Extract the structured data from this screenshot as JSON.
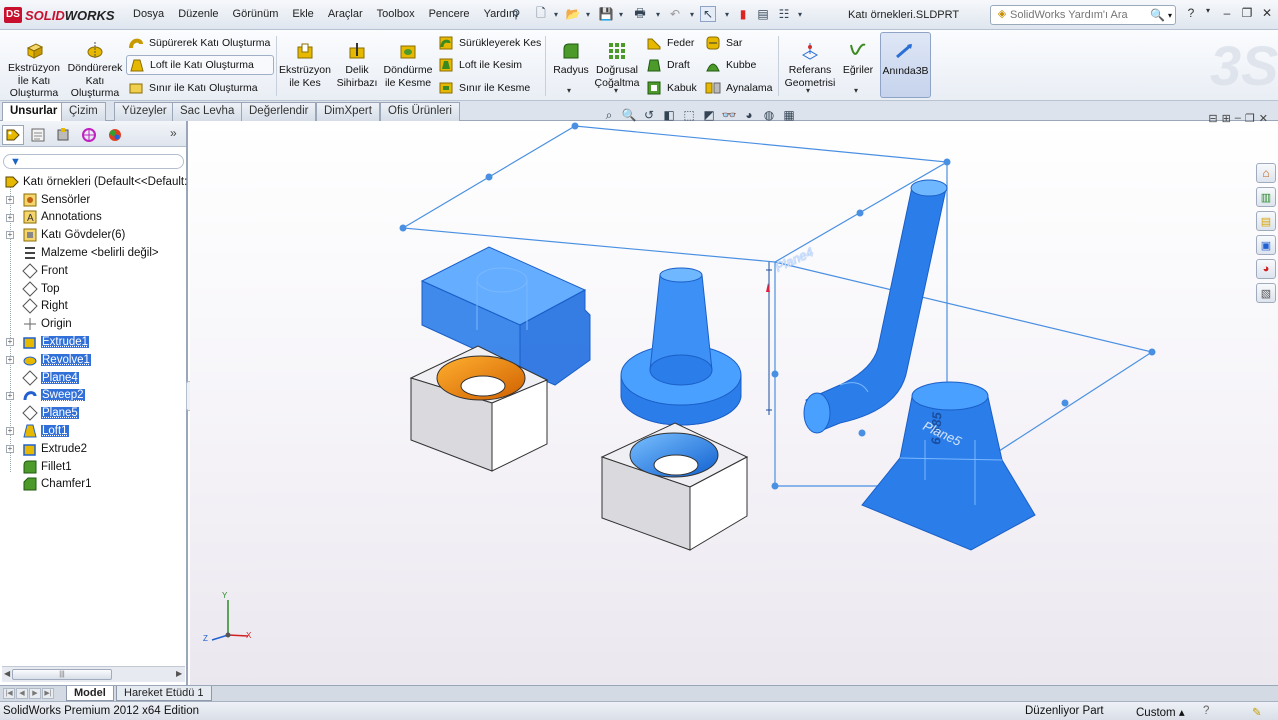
{
  "title_bar": {
    "app_name_prefix": "SOLID",
    "app_name_suffix": "WORKS",
    "document_title": "Katı örnekleri.SLDPRT",
    "help_search_placeholder": "SolidWorks Yardım'ı Ara"
  },
  "menus": [
    "Dosya",
    "Düzenle",
    "Görünüm",
    "Ekle",
    "Araçlar",
    "Toolbox",
    "Pencere",
    "Yardım"
  ],
  "command_manager": {
    "extrude_boss": "Ekstrüzyon İle Katı Oluşturma",
    "revolve_boss": "Döndürerek Katı Oluşturma",
    "sweep_boss": "Süpürerek Katı Oluşturma",
    "loft_boss": "Loft ile Katı Oluşturma",
    "boundary_boss": "Sınır ile Katı Oluşturma",
    "extrude_cut": "Ekstrüzyon ile Kes",
    "hole_wizard": "Delik Sihirbazı",
    "revolve_cut": "Döndürme ile Kesme",
    "sweep_cut": "Sürükleyerek Kes",
    "loft_cut": "Loft ile Kesim",
    "boundary_cut": "Sınır ile Kesme",
    "fillet": "Radyus",
    "linear_pattern": "Doğrusal Çoğaltma",
    "rib": "Feder",
    "draft": "Draft",
    "shell": "Kabuk",
    "wrap": "Sar",
    "dome": "Kubbe",
    "mirror": "Aynalama",
    "ref_geometry": "Referans Geometrisi",
    "curves": "Eğriler",
    "instant3d": "Anında3B"
  },
  "tabs": [
    "Unsurlar",
    "Çizim",
    "Yüzeyler",
    "Sac Levha",
    "Değerlendir",
    "DimXpert",
    "Ofis Ürünleri"
  ],
  "feature_tree": [
    {
      "label": "Katı örnekleri  (Default<<Default:",
      "icon": "part-icon",
      "selected": false,
      "expander": false,
      "root": true
    },
    {
      "label": "Sensörler",
      "icon": "sensor-icon",
      "selected": false,
      "expander": true
    },
    {
      "label": "Annotations",
      "icon": "annotations-icon",
      "selected": false,
      "expander": true
    },
    {
      "label": "Katı Gövdeler(6)",
      "icon": "solid-bodies-icon",
      "selected": false,
      "expander": true
    },
    {
      "label": "Malzeme <belirli değil>",
      "icon": "material-icon",
      "selected": false,
      "expander": false
    },
    {
      "label": "Front",
      "icon": "plane-icon",
      "selected": false,
      "expander": false
    },
    {
      "label": "Top",
      "icon": "plane-icon",
      "selected": false,
      "expander": false
    },
    {
      "label": "Right",
      "icon": "plane-icon",
      "selected": false,
      "expander": false
    },
    {
      "label": "Origin",
      "icon": "origin-icon",
      "selected": false,
      "expander": false
    },
    {
      "label": "Extrude1",
      "icon": "extrude-icon",
      "selected": true,
      "expander": true
    },
    {
      "label": "Revolve1",
      "icon": "revolve-icon",
      "selected": true,
      "expander": true
    },
    {
      "label": "Plane4",
      "icon": "plane-icon",
      "selected": true,
      "expander": false
    },
    {
      "label": "Sweep2",
      "icon": "sweep-icon",
      "selected": true,
      "expander": true
    },
    {
      "label": "Plane5",
      "icon": "plane-icon",
      "selected": true,
      "expander": false
    },
    {
      "label": "Loft1",
      "icon": "loft-icon",
      "selected": true,
      "expander": true
    },
    {
      "label": "Extrude2",
      "icon": "extrude-icon",
      "selected": false,
      "expander": true
    },
    {
      "label": "Fillet1",
      "icon": "fillet-icon",
      "selected": false,
      "expander": false
    },
    {
      "label": "Chamfer1",
      "icon": "chamfer-icon",
      "selected": false,
      "expander": false
    }
  ],
  "viewport": {
    "plane4_label": "Plane4",
    "plane5_label": "Plane5",
    "dimension": "6.485",
    "triad_x": "X",
    "triad_y": "Y",
    "triad_z": "Z"
  },
  "bottom_tabs": [
    "Model",
    "Hareket Etüdü 1"
  ],
  "status_bar": {
    "edition": "SolidWorks Premium 2012 x64 Edition",
    "mode": "Düzenliyor Part",
    "units": "Custom"
  },
  "colors": {
    "selection_blue": "#2b7de9",
    "plane_blue": "#4a90e2",
    "brand_red": "#c8102e",
    "tree_select": "#3070d8"
  }
}
